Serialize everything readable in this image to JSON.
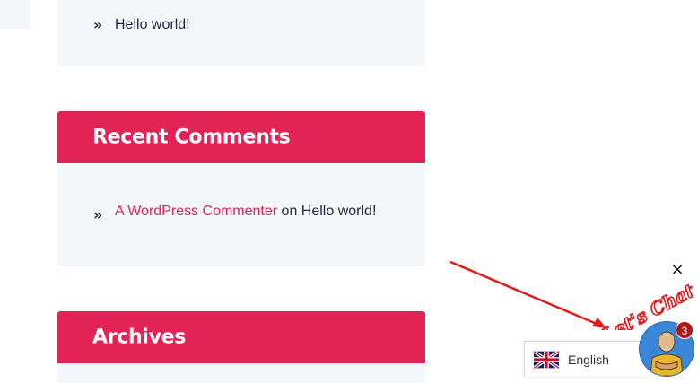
{
  "top_panel": {
    "item": "Hello world!"
  },
  "recent_comments": {
    "title": "Recent Comments",
    "items": [
      {
        "author": "A WordPress Commenter",
        "on": "on",
        "post": "Hello world!"
      }
    ]
  },
  "archives": {
    "title": "Archives"
  },
  "chat_widget": {
    "close_symbol": "×",
    "lets_chat": "Let's Chat",
    "unread_count": "3",
    "language": "English"
  },
  "colors": {
    "accent": "#e22356",
    "panel_bg": "#f3f7fa",
    "chat_blue": "#3a86d8",
    "badge_red": "#b1161b"
  },
  "icons": {
    "list_bullet": "chevron-double-right-icon",
    "flag": "uk-flag-icon"
  }
}
